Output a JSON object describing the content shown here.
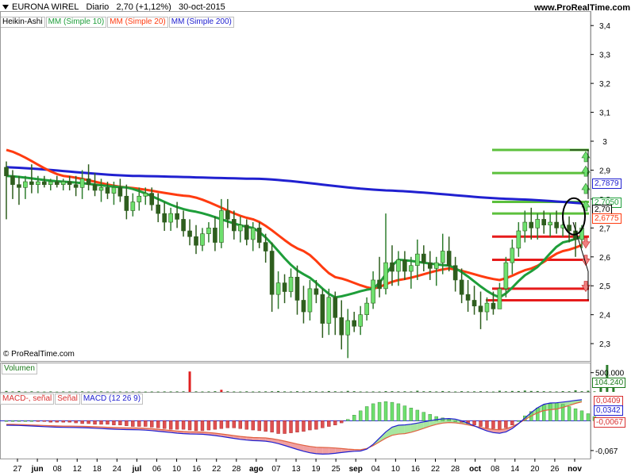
{
  "header": {
    "title": "EURONA WIREL",
    "period": "Diario",
    "quote": "2,70 (+1,12%)",
    "date": "30-oct-2015",
    "site": "www.ProRealTime.com"
  },
  "legend": {
    "price_type": "Heikin-Ashi",
    "ma10": "MM (Simple 10)",
    "ma20": "MM (Simple 20)",
    "ma200": "MM (Simple 200)"
  },
  "watermark": "© ProRealTime.com",
  "volume_panel": {
    "label": "Volumen",
    "tick": "500.000",
    "last_value": "104.240"
  },
  "macd_panel": {
    "label_a": "MACD-, señal",
    "label_b": "Señal",
    "label_c": "MACD (12 26 9)",
    "tick_neg": "-0,067",
    "value_signal": "0,0409",
    "value_macd": "0,0342",
    "value_hist": "-0,0067"
  },
  "price_tags": {
    "ma200": "2,7879",
    "ma10": "2,7050",
    "last": "2,70",
    "ma20": "2,6775"
  },
  "colors": {
    "ma10": "#1e9e3a",
    "ma20": "#ff3b10",
    "ma200": "#2020d0",
    "candle_up": "#6ee06e",
    "candle_down": "#2e5e1e",
    "volume": "#2e7d2e",
    "volume_spike": "#e02020",
    "support": "#e61b1b",
    "resistance": "#5cc03c"
  },
  "chart_data": [
    {
      "type": "candlestick",
      "name": "EURONA WIREL",
      "y_ticks": [
        "2,3",
        "2,4",
        "2,5",
        "2,6",
        "2,7",
        "2,8",
        "2,9",
        "3",
        "3,1",
        "3,2",
        "3,3",
        "3,4"
      ],
      "y_tick_values": [
        2.3,
        2.4,
        2.5,
        2.6,
        2.7,
        2.8,
        2.9,
        3.0,
        3.1,
        3.2,
        3.3,
        3.4
      ],
      "ylim": [
        2.24,
        3.45
      ],
      "x_ticks": [
        "27",
        "jun",
        "08",
        "12",
        "18",
        "24",
        "jul",
        "06",
        "10",
        "16",
        "22",
        "28",
        "ago",
        "07",
        "13",
        "19",
        "25",
        "sep",
        "04",
        "10",
        "16",
        "22",
        "28",
        "oct",
        "08",
        "14",
        "20",
        "26",
        "nov"
      ],
      "date_range": [
        "2015-05-26",
        "2015-10-30"
      ],
      "ohlc": [
        {
          "o": 2.91,
          "h": 2.93,
          "l": 2.73,
          "c": 2.88
        },
        {
          "o": 2.88,
          "h": 2.9,
          "l": 2.8,
          "c": 2.85
        },
        {
          "o": 2.85,
          "h": 2.88,
          "l": 2.78,
          "c": 2.84
        },
        {
          "o": 2.84,
          "h": 2.88,
          "l": 2.8,
          "c": 2.86
        },
        {
          "o": 2.86,
          "h": 2.92,
          "l": 2.82,
          "c": 2.85
        },
        {
          "o": 2.85,
          "h": 2.88,
          "l": 2.82,
          "c": 2.86
        },
        {
          "o": 2.86,
          "h": 2.88,
          "l": 2.84,
          "c": 2.85
        },
        {
          "o": 2.85,
          "h": 2.87,
          "l": 2.83,
          "c": 2.86
        },
        {
          "o": 2.86,
          "h": 2.88,
          "l": 2.84,
          "c": 2.85
        },
        {
          "o": 2.85,
          "h": 2.87,
          "l": 2.83,
          "c": 2.86
        },
        {
          "o": 2.86,
          "h": 2.88,
          "l": 2.83,
          "c": 2.85
        },
        {
          "o": 2.85,
          "h": 2.88,
          "l": 2.81,
          "c": 2.84
        },
        {
          "o": 2.84,
          "h": 2.9,
          "l": 2.8,
          "c": 2.87
        },
        {
          "o": 2.87,
          "h": 2.92,
          "l": 2.83,
          "c": 2.85
        },
        {
          "o": 2.85,
          "h": 2.89,
          "l": 2.81,
          "c": 2.83
        },
        {
          "o": 2.83,
          "h": 2.87,
          "l": 2.79,
          "c": 2.84
        },
        {
          "o": 2.84,
          "h": 2.86,
          "l": 2.8,
          "c": 2.82
        },
        {
          "o": 2.82,
          "h": 2.86,
          "l": 2.78,
          "c": 2.84
        },
        {
          "o": 2.84,
          "h": 2.87,
          "l": 2.79,
          "c": 2.81
        },
        {
          "o": 2.81,
          "h": 2.85,
          "l": 2.73,
          "c": 2.76
        },
        {
          "o": 2.76,
          "h": 2.82,
          "l": 2.74,
          "c": 2.79
        },
        {
          "o": 2.79,
          "h": 2.84,
          "l": 2.76,
          "c": 2.81
        },
        {
          "o": 2.81,
          "h": 2.84,
          "l": 2.78,
          "c": 2.82
        },
        {
          "o": 2.82,
          "h": 2.84,
          "l": 2.76,
          "c": 2.78
        },
        {
          "o": 2.78,
          "h": 2.82,
          "l": 2.72,
          "c": 2.75
        },
        {
          "o": 2.75,
          "h": 2.79,
          "l": 2.69,
          "c": 2.72
        },
        {
          "o": 2.72,
          "h": 2.77,
          "l": 2.69,
          "c": 2.75
        },
        {
          "o": 2.75,
          "h": 2.79,
          "l": 2.7,
          "c": 2.73
        },
        {
          "o": 2.73,
          "h": 2.76,
          "l": 2.67,
          "c": 2.69
        },
        {
          "o": 2.69,
          "h": 2.73,
          "l": 2.64,
          "c": 2.67
        },
        {
          "o": 2.67,
          "h": 2.71,
          "l": 2.61,
          "c": 2.64
        },
        {
          "o": 2.64,
          "h": 2.7,
          "l": 2.62,
          "c": 2.68
        },
        {
          "o": 2.68,
          "h": 2.72,
          "l": 2.65,
          "c": 2.7
        },
        {
          "o": 2.7,
          "h": 2.74,
          "l": 2.62,
          "c": 2.65
        },
        {
          "o": 2.65,
          "h": 2.8,
          "l": 2.63,
          "c": 2.76
        },
        {
          "o": 2.76,
          "h": 2.8,
          "l": 2.7,
          "c": 2.73
        },
        {
          "o": 2.73,
          "h": 2.76,
          "l": 2.66,
          "c": 2.69
        },
        {
          "o": 2.69,
          "h": 2.74,
          "l": 2.65,
          "c": 2.71
        },
        {
          "o": 2.71,
          "h": 2.73,
          "l": 2.64,
          "c": 2.66
        },
        {
          "o": 2.66,
          "h": 2.72,
          "l": 2.62,
          "c": 2.7
        },
        {
          "o": 2.7,
          "h": 2.72,
          "l": 2.63,
          "c": 2.65
        },
        {
          "o": 2.65,
          "h": 2.68,
          "l": 2.58,
          "c": 2.62
        },
        {
          "o": 2.62,
          "h": 2.65,
          "l": 2.41,
          "c": 2.47
        },
        {
          "o": 2.47,
          "h": 2.55,
          "l": 2.42,
          "c": 2.51
        },
        {
          "o": 2.51,
          "h": 2.54,
          "l": 2.44,
          "c": 2.48
        },
        {
          "o": 2.48,
          "h": 2.56,
          "l": 2.46,
          "c": 2.53
        },
        {
          "o": 2.53,
          "h": 2.57,
          "l": 2.4,
          "c": 2.45
        },
        {
          "o": 2.45,
          "h": 2.5,
          "l": 2.37,
          "c": 2.41
        },
        {
          "o": 2.41,
          "h": 2.52,
          "l": 2.38,
          "c": 2.49
        },
        {
          "o": 2.49,
          "h": 2.52,
          "l": 2.44,
          "c": 2.47
        },
        {
          "o": 2.47,
          "h": 2.49,
          "l": 2.32,
          "c": 2.37
        },
        {
          "o": 2.37,
          "h": 2.49,
          "l": 2.33,
          "c": 2.46
        },
        {
          "o": 2.46,
          "h": 2.48,
          "l": 2.33,
          "c": 2.39
        },
        {
          "o": 2.39,
          "h": 2.45,
          "l": 2.28,
          "c": 2.33
        },
        {
          "o": 2.33,
          "h": 2.42,
          "l": 2.25,
          "c": 2.38
        },
        {
          "o": 2.38,
          "h": 2.41,
          "l": 2.34,
          "c": 2.36
        },
        {
          "o": 2.36,
          "h": 2.43,
          "l": 2.33,
          "c": 2.4
        },
        {
          "o": 2.4,
          "h": 2.46,
          "l": 2.38,
          "c": 2.44
        },
        {
          "o": 2.44,
          "h": 2.55,
          "l": 2.42,
          "c": 2.52
        },
        {
          "o": 2.52,
          "h": 2.6,
          "l": 2.46,
          "c": 2.49
        },
        {
          "o": 2.49,
          "h": 2.75,
          "l": 2.47,
          "c": 2.58
        },
        {
          "o": 2.58,
          "h": 2.64,
          "l": 2.5,
          "c": 2.55
        },
        {
          "o": 2.55,
          "h": 2.62,
          "l": 2.5,
          "c": 2.59
        },
        {
          "o": 2.59,
          "h": 2.62,
          "l": 2.52,
          "c": 2.55
        },
        {
          "o": 2.55,
          "h": 2.6,
          "l": 2.49,
          "c": 2.57
        },
        {
          "o": 2.57,
          "h": 2.66,
          "l": 2.52,
          "c": 2.61
        },
        {
          "o": 2.61,
          "h": 2.64,
          "l": 2.55,
          "c": 2.58
        },
        {
          "o": 2.58,
          "h": 2.62,
          "l": 2.52,
          "c": 2.56
        },
        {
          "o": 2.56,
          "h": 2.6,
          "l": 2.5,
          "c": 2.58
        },
        {
          "o": 2.58,
          "h": 2.68,
          "l": 2.54,
          "c": 2.62
        },
        {
          "o": 2.62,
          "h": 2.67,
          "l": 2.55,
          "c": 2.57
        },
        {
          "o": 2.57,
          "h": 2.6,
          "l": 2.48,
          "c": 2.52
        },
        {
          "o": 2.52,
          "h": 2.56,
          "l": 2.44,
          "c": 2.47
        },
        {
          "o": 2.47,
          "h": 2.52,
          "l": 2.41,
          "c": 2.45
        },
        {
          "o": 2.45,
          "h": 2.5,
          "l": 2.4,
          "c": 2.43
        },
        {
          "o": 2.43,
          "h": 2.48,
          "l": 2.35,
          "c": 2.41
        },
        {
          "o": 2.41,
          "h": 2.46,
          "l": 2.38,
          "c": 2.44
        },
        {
          "o": 2.44,
          "h": 2.48,
          "l": 2.4,
          "c": 2.42
        },
        {
          "o": 2.42,
          "h": 2.51,
          "l": 2.42,
          "c": 2.49
        },
        {
          "o": 2.49,
          "h": 2.6,
          "l": 2.46,
          "c": 2.58
        },
        {
          "o": 2.58,
          "h": 2.66,
          "l": 2.54,
          "c": 2.63
        },
        {
          "o": 2.63,
          "h": 2.72,
          "l": 2.6,
          "c": 2.69
        },
        {
          "o": 2.69,
          "h": 2.76,
          "l": 2.65,
          "c": 2.72
        },
        {
          "o": 2.72,
          "h": 2.77,
          "l": 2.66,
          "c": 2.7
        },
        {
          "o": 2.7,
          "h": 2.75,
          "l": 2.66,
          "c": 2.73
        },
        {
          "o": 2.73,
          "h": 2.76,
          "l": 2.68,
          "c": 2.71
        },
        {
          "o": 2.71,
          "h": 2.75,
          "l": 2.67,
          "c": 2.72
        },
        {
          "o": 2.72,
          "h": 2.76,
          "l": 2.68,
          "c": 2.7
        },
        {
          "o": 2.7,
          "h": 2.74,
          "l": 2.67,
          "c": 2.71
        },
        {
          "o": 2.71,
          "h": 2.74,
          "l": 2.65,
          "c": 2.69
        },
        {
          "o": 2.69,
          "h": 2.72,
          "l": 2.6,
          "c": 2.66
        },
        {
          "o": 2.66,
          "h": 2.71,
          "l": 2.63,
          "c": 2.7
        }
      ],
      "moving_averages": {
        "MM (Simple 10)": {
          "x_index": [
            0,
            9,
            19,
            29,
            39,
            47,
            52,
            58,
            62,
            70,
            78,
            83,
            88,
            96
          ],
          "values": [
            2.88,
            2.86,
            2.84,
            2.76,
            2.7,
            2.54,
            2.46,
            2.49,
            2.59,
            2.57,
            2.46,
            2.55,
            2.65,
            2.71
          ]
        },
        "MM (Simple 20)": {
          "x_index": [
            0,
            9,
            19,
            29,
            39,
            47,
            52,
            58,
            62,
            70,
            78,
            83,
            88,
            96
          ],
          "values": [
            2.97,
            2.88,
            2.84,
            2.81,
            2.73,
            2.62,
            2.53,
            2.49,
            2.52,
            2.56,
            2.52,
            2.56,
            2.62,
            2.68
          ]
        },
        "MM (Simple 200)": {
          "x_index": [
            0,
            20,
            40,
            60,
            80,
            96
          ],
          "values": [
            2.91,
            2.88,
            2.87,
            2.83,
            2.8,
            2.78
          ]
        }
      },
      "horizontal_levels": {
        "resistance": [
          2.97,
          2.89,
          2.79,
          2.75
        ],
        "support": [
          2.67,
          2.59,
          2.49,
          2.45
        ]
      }
    },
    {
      "type": "bar",
      "name": "Volumen",
      "values": [
        24000,
        11000,
        22000,
        8000,
        15000,
        9000,
        7000,
        12000,
        6000,
        11000,
        9000,
        8000,
        14000,
        7000,
        10000,
        13000,
        8000,
        6000,
        10000,
        9000,
        12000,
        7000,
        8000,
        10000,
        9000,
        12000,
        11000,
        13000,
        15000,
        530000,
        14000,
        10000,
        12000,
        18000,
        55000,
        16000,
        11000,
        9000,
        15000,
        10000,
        12000,
        14000,
        16000,
        22000,
        13000,
        10000,
        18000,
        12000,
        16000,
        14000,
        12000,
        22000,
        16000,
        10000,
        26000,
        18000,
        11000,
        9000,
        12000,
        10000,
        20000,
        18000,
        14000,
        16000,
        12000,
        30000,
        16000,
        18000,
        12000,
        22000,
        14000,
        10000,
        18000,
        12000,
        14000,
        17000,
        13000,
        9000,
        30000,
        15000,
        24000,
        22000,
        34000,
        24000,
        22000,
        18000,
        14000,
        12000,
        20000,
        16000,
        40000,
        18000,
        30000,
        14000,
        130000,
        700000,
        104240
      ],
      "spike_indices": [
        29,
        34
      ]
    },
    {
      "type": "line",
      "name": "MACD (12 26 9)",
      "series": [
        {
          "name": "MACD",
          "x_index": [
            0,
            10,
            20,
            30,
            40,
            50,
            56,
            62,
            70,
            78,
            86,
            92,
            96
          ],
          "values": [
            -0.01,
            -0.015,
            -0.02,
            -0.03,
            -0.045,
            -0.075,
            -0.068,
            -0.01,
            0.005,
            -0.028,
            0.04,
            0.048,
            0.0342
          ]
        },
        {
          "name": "Señal",
          "x_index": [
            0,
            10,
            20,
            30,
            40,
            50,
            56,
            62,
            70,
            78,
            86,
            92,
            96
          ],
          "values": [
            -0.008,
            -0.012,
            -0.016,
            -0.025,
            -0.038,
            -0.06,
            -0.065,
            -0.03,
            -0.004,
            -0.02,
            0.025,
            0.044,
            0.0409
          ]
        }
      ],
      "histogram": [
        0,
        0,
        0,
        0,
        0,
        -0.001,
        -0.001,
        -0.002,
        -0.002,
        -0.002,
        -0.002,
        -0.003,
        -0.004,
        -0.004,
        -0.005,
        -0.005,
        -0.005,
        -0.006,
        -0.006,
        -0.007,
        -0.008,
        -0.008,
        -0.008,
        -0.009,
        -0.01,
        -0.011,
        -0.012,
        -0.012,
        -0.012,
        -0.013,
        -0.014,
        -0.014,
        -0.013,
        -0.012,
        -0.011,
        -0.01,
        -0.01,
        -0.011,
        -0.012,
        -0.013,
        -0.014,
        -0.015,
        -0.016,
        -0.018,
        -0.018,
        -0.017,
        -0.016,
        -0.015,
        -0.013,
        -0.012,
        -0.01,
        -0.008,
        -0.006,
        -0.003,
        0.002,
        0.008,
        0.014,
        0.02,
        0.024,
        0.026,
        0.027,
        0.026,
        0.024,
        0.021,
        0.018,
        0.015,
        0.012,
        0.009,
        0.006,
        0.004,
        0.002,
        0.0,
        -0.002,
        -0.004,
        -0.006,
        -0.008,
        -0.01,
        -0.011,
        -0.012,
        -0.01,
        -0.006,
        0.0,
        0.007,
        0.013,
        0.018,
        0.022,
        0.024,
        0.025,
        0.023,
        0.02,
        0.017,
        0.014,
        0.01,
        0.006,
        0.002,
        -0.004,
        -0.0067
      ],
      "y_ticks": [
        "-0,067"
      ],
      "y_tick_values": [
        -0.067
      ]
    }
  ]
}
